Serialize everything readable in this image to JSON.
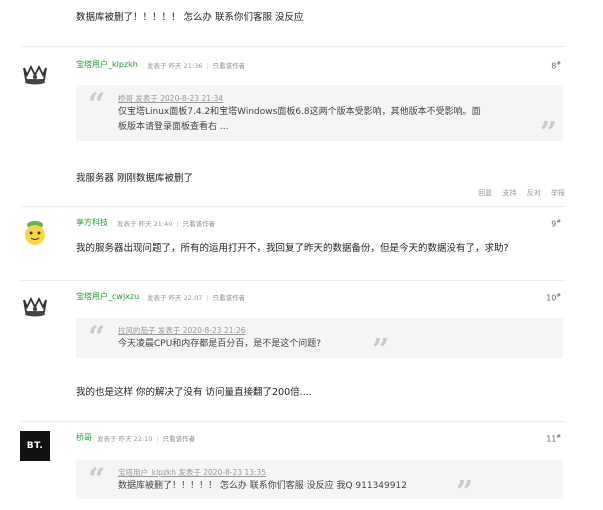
{
  "top_text": "数据库被删了！！！！！ 怎么办 联系你们客服 没反应",
  "posts": [
    {
      "username": "宝塔用户_klpzkh",
      "posted": "发表于 昨天 21:36",
      "only_author": "只看该作者",
      "floor": "8",
      "quote_head": "桥哥 发表于 2020-8-23 21:34",
      "quote_line1": "仅宝塔Linux面板7.4.2和宝塔Windows面板6.8这两个版本受影响，其他版本不受影响。面",
      "quote_line2": "板版本请登录面板查看右 ...",
      "body": "我服务器 刚刚数据库被删了",
      "actions": [
        "回复",
        "支持",
        "反对",
        "举报"
      ]
    },
    {
      "username": "享方科技",
      "posted": "发表于 昨天 21:40",
      "only_author": "只看该作者",
      "floor": "9",
      "body": "我的服务器出现问题了，所有的运用打开不，我回复了昨天的数据备份，但是今天的数据没有了，求助?"
    },
    {
      "username": "宝塔用户_cwjxzu",
      "posted": "发表于 昨天 22:07",
      "only_author": "只看该作者",
      "floor": "10",
      "quote_head": "拉风的茄子 发表于 2020-8-23 21:26",
      "quote_line1": "今天凌晨CPU和内存都是百分百，是不是这个问题?",
      "body": "我的也是这样 你的解决了没有 访问量直接翻了200倍...."
    },
    {
      "username": "桥哥",
      "posted": "发表于 昨天 22:10",
      "only_author": "只看该作者",
      "floor": "11",
      "avatar_text": "BT.",
      "quote_head": "宝塔用户_klpzkh 发表于 2020-8-23 13:35",
      "quote_line1": "数据库被删了！！！！！ 怎么办 联系你们客服 没反应 我Q  911349912"
    }
  ],
  "colors": {
    "username": "#2a9a3a",
    "quote_bg": "#f5f5f5",
    "quote_mark": "#c4cdd6"
  }
}
